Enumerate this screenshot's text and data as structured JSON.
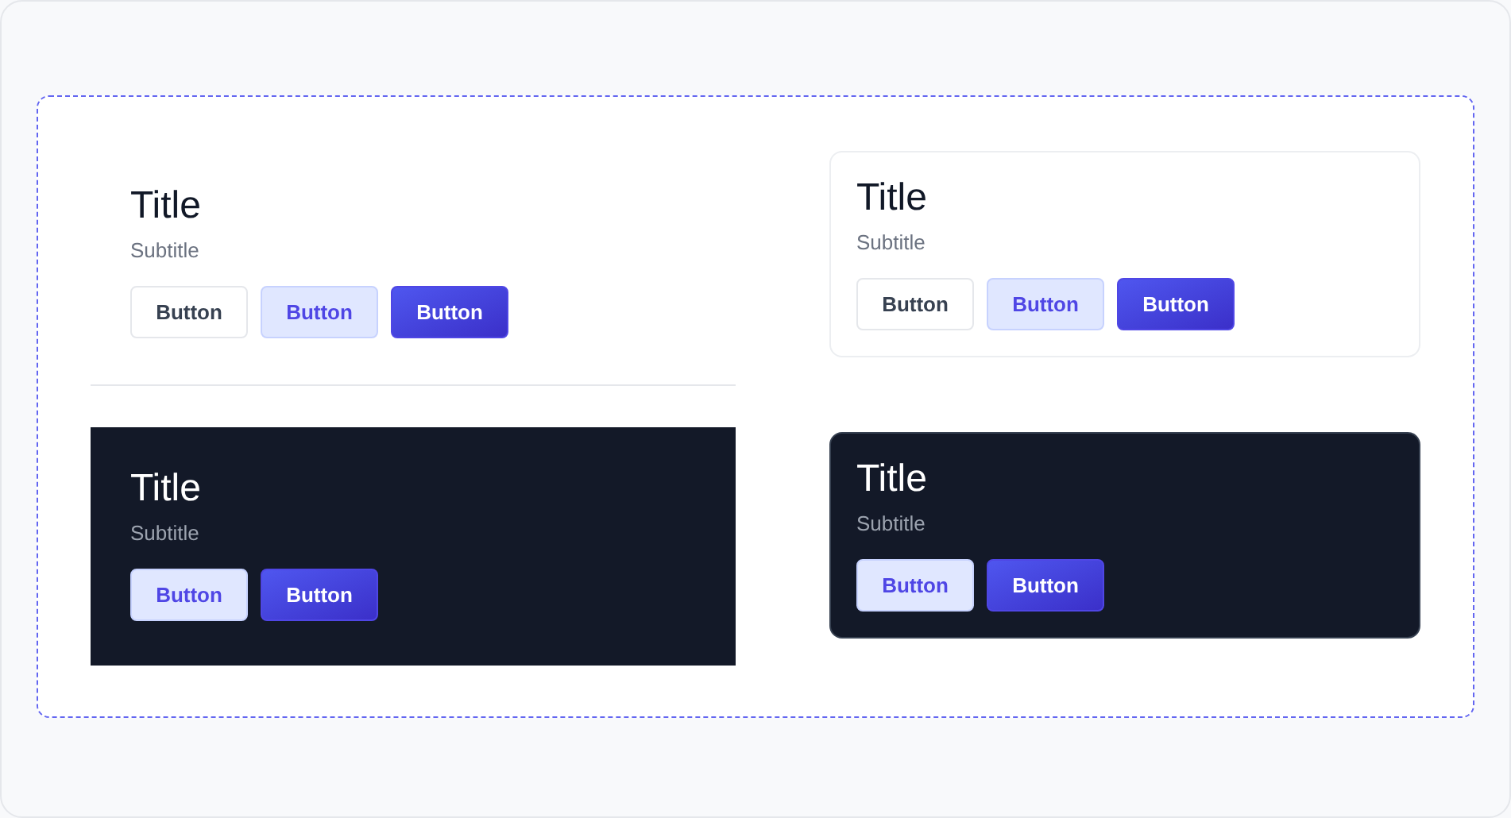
{
  "panels": [
    {
      "dark": false,
      "framed": false,
      "divider_below": true,
      "title": "Title",
      "subtitle": "Subtitle",
      "buttons": [
        {
          "label": "Button",
          "kind": "outline"
        },
        {
          "label": "Button",
          "kind": "soft"
        },
        {
          "label": "Button",
          "kind": "solid"
        }
      ]
    },
    {
      "dark": true,
      "framed": false,
      "divider_below": false,
      "title": "Title",
      "subtitle": "Subtitle",
      "buttons": [
        {
          "label": "Button",
          "kind": "soft"
        },
        {
          "label": "Button",
          "kind": "solid"
        }
      ]
    },
    {
      "dark": false,
      "framed": true,
      "divider_below": false,
      "title": "Title",
      "subtitle": "Subtitle",
      "buttons": [
        {
          "label": "Button",
          "kind": "outline"
        },
        {
          "label": "Button",
          "kind": "soft"
        },
        {
          "label": "Button",
          "kind": "solid"
        }
      ]
    },
    {
      "dark": true,
      "framed": true,
      "divider_below": false,
      "title": "Title",
      "subtitle": "Subtitle",
      "buttons": [
        {
          "label": "Button",
          "kind": "soft"
        },
        {
          "label": "Button",
          "kind": "solid"
        }
      ]
    }
  ]
}
